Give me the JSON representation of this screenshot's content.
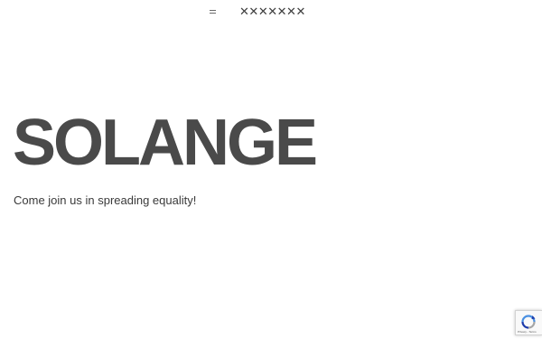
{
  "header": {
    "menu_icon": "hamburger-icon",
    "logo_glyphs": [
      "✕",
      "✕",
      "✕",
      "✕",
      "✕",
      "✕",
      "✕"
    ]
  },
  "hero": {
    "title": "SOLANGE",
    "subtitle": "Come join us in spreading equality!"
  },
  "recaptcha": {
    "icon": "recaptcha-icon",
    "footer_text": "Privacy - Terms"
  },
  "colors": {
    "text": "#4a4a4a",
    "background": "#ffffff",
    "recaptcha_blue": "#4a90e2"
  }
}
